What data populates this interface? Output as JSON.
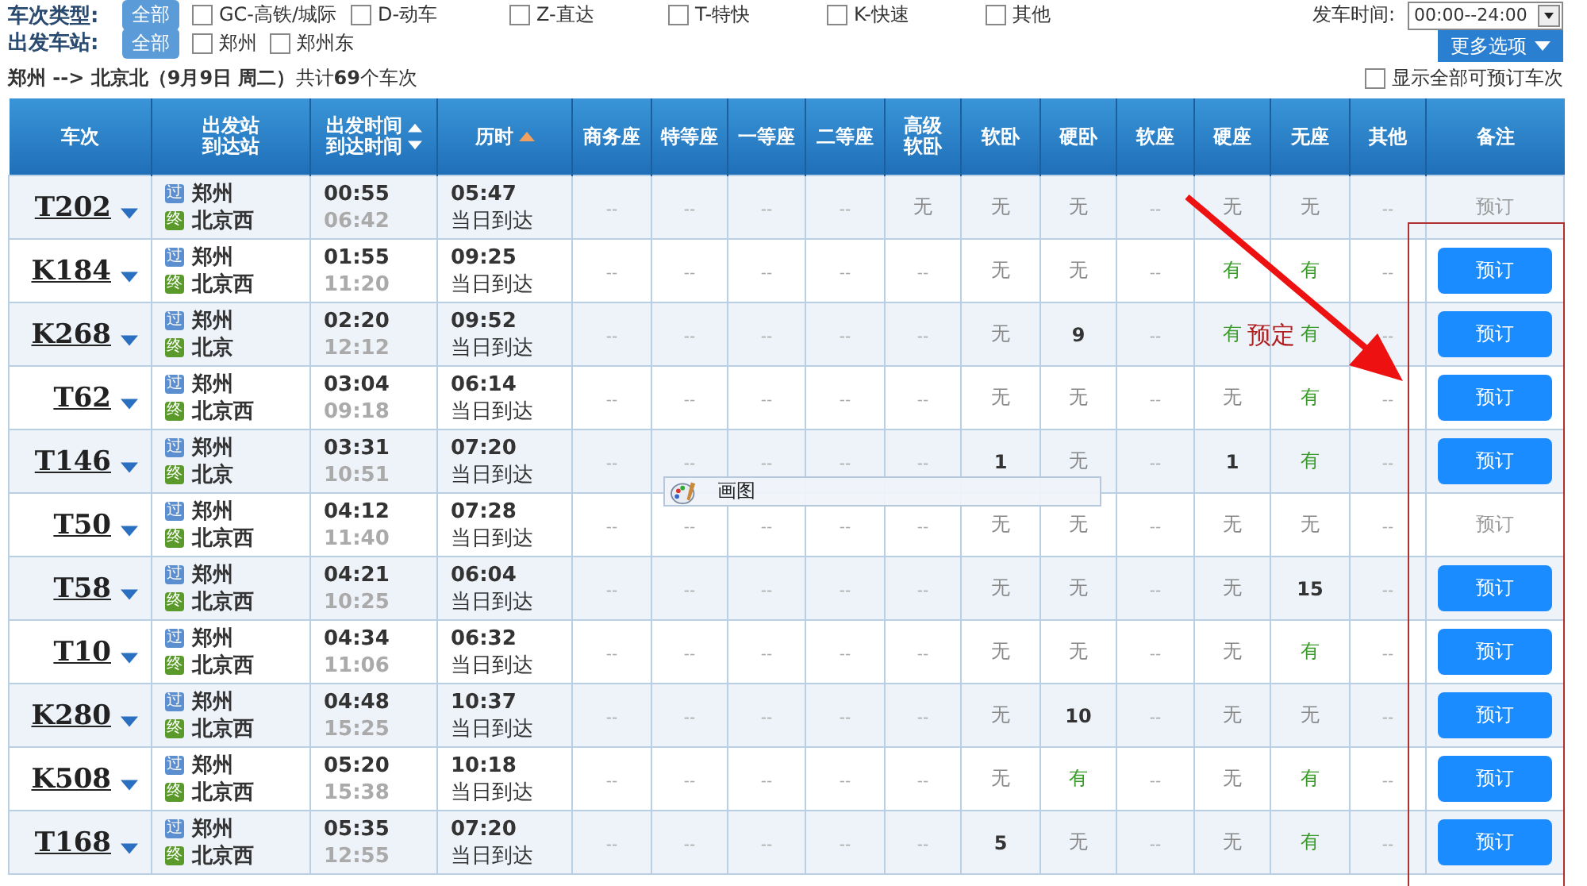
{
  "filters": {
    "train_type": {
      "label": "车次类型:",
      "all": {
        "label": "全部",
        "selected": true
      },
      "options": [
        {
          "label": "GC-高铁/城际",
          "checked": false
        },
        {
          "label": "D-动车",
          "checked": false
        },
        {
          "label": "Z-直达",
          "checked": false
        },
        {
          "label": "T-特快",
          "checked": false
        },
        {
          "label": "K-快速",
          "checked": false
        },
        {
          "label": "其他",
          "checked": false
        }
      ]
    },
    "depart_time": {
      "label": "发车时间:",
      "value": "00:00--24:00"
    },
    "station": {
      "label": "出发车站:",
      "all": {
        "label": "全部",
        "selected": true
      },
      "options": [
        {
          "label": "郑州",
          "checked": false
        },
        {
          "label": "郑州东",
          "checked": false
        }
      ]
    },
    "more_button": "更多选项"
  },
  "summary": "**郑州 --> 北京北（9月9日  周二）**共计**69**个车次",
  "show_all": {
    "label": "显示全部可预订车次",
    "checked": false
  },
  "columns": [
    {
      "label": "车次"
    },
    {
      "label": "出发站",
      "label2": "到达站"
    },
    {
      "label": "出发时间",
      "label2": "到达时间",
      "sort_up": true,
      "sort_down": true
    },
    {
      "label": "历时",
      "sort_up": true,
      "sort_down": false
    },
    {
      "label": "商务座"
    },
    {
      "label": "特等座"
    },
    {
      "label": "一等座"
    },
    {
      "label": "二等座"
    },
    {
      "label": "高级",
      "label2": "软卧"
    },
    {
      "label": "软卧"
    },
    {
      "label": "硬卧"
    },
    {
      "label": "软座"
    },
    {
      "label": "硬座"
    },
    {
      "label": "无座"
    },
    {
      "label": "其他"
    },
    {
      "label": "备注"
    }
  ],
  "rows": [
    {
      "train": "T202",
      "from_tag": "过",
      "from": "郑州",
      "to_tag": "终",
      "to": "北京西",
      "depart": "00:55",
      "arrive": "06:42",
      "duration": "05:47",
      "arrival_day": "当日到达",
      "seats": [
        {
          "text": "--",
          "kind": "na"
        },
        {
          "text": "--",
          "kind": "na"
        },
        {
          "text": "--",
          "kind": "na"
        },
        {
          "text": "--",
          "kind": "na"
        },
        {
          "text": "无",
          "kind": "none"
        },
        {
          "text": "无",
          "kind": "none"
        },
        {
          "text": "无",
          "kind": "none"
        },
        {
          "text": "--",
          "kind": "na"
        },
        {
          "text": "无",
          "kind": "none"
        },
        {
          "text": "无",
          "kind": "none"
        },
        {
          "text": "--",
          "kind": "na"
        }
      ],
      "remark": {
        "text": "预订",
        "enabled": false
      }
    },
    {
      "train": "K184",
      "from_tag": "过",
      "from": "郑州",
      "to_tag": "终",
      "to": "北京西",
      "depart": "01:55",
      "arrive": "11:20",
      "duration": "09:25",
      "arrival_day": "当日到达",
      "seats": [
        {
          "text": "--",
          "kind": "na"
        },
        {
          "text": "--",
          "kind": "na"
        },
        {
          "text": "--",
          "kind": "na"
        },
        {
          "text": "--",
          "kind": "na"
        },
        {
          "text": "--",
          "kind": "na"
        },
        {
          "text": "无",
          "kind": "none"
        },
        {
          "text": "无",
          "kind": "none"
        },
        {
          "text": "--",
          "kind": "na"
        },
        {
          "text": "有",
          "kind": "yes"
        },
        {
          "text": "有",
          "kind": "yes"
        },
        {
          "text": "--",
          "kind": "na"
        }
      ],
      "remark": {
        "text": "预订",
        "enabled": true
      }
    },
    {
      "train": "K268",
      "from_tag": "过",
      "from": "郑州",
      "to_tag": "终",
      "to": "北京",
      "depart": "02:20",
      "arrive": "12:12",
      "duration": "09:52",
      "arrival_day": "当日到达",
      "seats": [
        {
          "text": "--",
          "kind": "na"
        },
        {
          "text": "--",
          "kind": "na"
        },
        {
          "text": "--",
          "kind": "na"
        },
        {
          "text": "--",
          "kind": "na"
        },
        {
          "text": "--",
          "kind": "na"
        },
        {
          "text": "无",
          "kind": "none"
        },
        {
          "text": "9",
          "kind": "num"
        },
        {
          "text": "--",
          "kind": "na"
        },
        {
          "text": "有",
          "kind": "yes"
        },
        {
          "text": "有",
          "kind": "yes"
        },
        {
          "text": "--",
          "kind": "na"
        }
      ],
      "remark": {
        "text": "预订",
        "enabled": true
      }
    },
    {
      "train": "T62",
      "from_tag": "过",
      "from": "郑州",
      "to_tag": "终",
      "to": "北京西",
      "depart": "03:04",
      "arrive": "09:18",
      "duration": "06:14",
      "arrival_day": "当日到达",
      "seats": [
        {
          "text": "--",
          "kind": "na"
        },
        {
          "text": "--",
          "kind": "na"
        },
        {
          "text": "--",
          "kind": "na"
        },
        {
          "text": "--",
          "kind": "na"
        },
        {
          "text": "--",
          "kind": "na"
        },
        {
          "text": "无",
          "kind": "none"
        },
        {
          "text": "无",
          "kind": "none"
        },
        {
          "text": "--",
          "kind": "na"
        },
        {
          "text": "无",
          "kind": "none"
        },
        {
          "text": "有",
          "kind": "yes"
        },
        {
          "text": "--",
          "kind": "na"
        }
      ],
      "remark": {
        "text": "预订",
        "enabled": true
      }
    },
    {
      "train": "T146",
      "from_tag": "过",
      "from": "郑州",
      "to_tag": "终",
      "to": "北京",
      "depart": "03:31",
      "arrive": "10:51",
      "duration": "07:20",
      "arrival_day": "当日到达",
      "seats": [
        {
          "text": "--",
          "kind": "na"
        },
        {
          "text": "--",
          "kind": "na"
        },
        {
          "text": "--",
          "kind": "na"
        },
        {
          "text": "--",
          "kind": "na"
        },
        {
          "text": "--",
          "kind": "na"
        },
        {
          "text": "1",
          "kind": "num"
        },
        {
          "text": "无",
          "kind": "none"
        },
        {
          "text": "--",
          "kind": "na"
        },
        {
          "text": "1",
          "kind": "num"
        },
        {
          "text": "有",
          "kind": "yes"
        },
        {
          "text": "--",
          "kind": "na"
        }
      ],
      "remark": {
        "text": "预订",
        "enabled": true
      }
    },
    {
      "train": "T50",
      "from_tag": "过",
      "from": "郑州",
      "to_tag": "终",
      "to": "北京西",
      "depart": "04:12",
      "arrive": "11:40",
      "duration": "07:28",
      "arrival_day": "当日到达",
      "seats": [
        {
          "text": "--",
          "kind": "na"
        },
        {
          "text": "--",
          "kind": "na"
        },
        {
          "text": "--",
          "kind": "na"
        },
        {
          "text": "--",
          "kind": "na"
        },
        {
          "text": "--",
          "kind": "na"
        },
        {
          "text": "无",
          "kind": "none"
        },
        {
          "text": "无",
          "kind": "none"
        },
        {
          "text": "--",
          "kind": "na"
        },
        {
          "text": "无",
          "kind": "none"
        },
        {
          "text": "无",
          "kind": "none"
        },
        {
          "text": "--",
          "kind": "na"
        }
      ],
      "remark": {
        "text": "预订",
        "enabled": false
      }
    },
    {
      "train": "T58",
      "from_tag": "过",
      "from": "郑州",
      "to_tag": "终",
      "to": "北京西",
      "depart": "04:21",
      "arrive": "10:25",
      "duration": "06:04",
      "arrival_day": "当日到达",
      "seats": [
        {
          "text": "--",
          "kind": "na"
        },
        {
          "text": "--",
          "kind": "na"
        },
        {
          "text": "--",
          "kind": "na"
        },
        {
          "text": "--",
          "kind": "na"
        },
        {
          "text": "--",
          "kind": "na"
        },
        {
          "text": "无",
          "kind": "none"
        },
        {
          "text": "无",
          "kind": "none"
        },
        {
          "text": "--",
          "kind": "na"
        },
        {
          "text": "无",
          "kind": "none"
        },
        {
          "text": "15",
          "kind": "num"
        },
        {
          "text": "--",
          "kind": "na"
        }
      ],
      "remark": {
        "text": "预订",
        "enabled": true
      }
    },
    {
      "train": "T10",
      "from_tag": "过",
      "from": "郑州",
      "to_tag": "终",
      "to": "北京西",
      "depart": "04:34",
      "arrive": "11:06",
      "duration": "06:32",
      "arrival_day": "当日到达",
      "seats": [
        {
          "text": "--",
          "kind": "na"
        },
        {
          "text": "--",
          "kind": "na"
        },
        {
          "text": "--",
          "kind": "na"
        },
        {
          "text": "--",
          "kind": "na"
        },
        {
          "text": "--",
          "kind": "na"
        },
        {
          "text": "无",
          "kind": "none"
        },
        {
          "text": "无",
          "kind": "none"
        },
        {
          "text": "--",
          "kind": "na"
        },
        {
          "text": "无",
          "kind": "none"
        },
        {
          "text": "有",
          "kind": "yes"
        },
        {
          "text": "--",
          "kind": "na"
        }
      ],
      "remark": {
        "text": "预订",
        "enabled": true
      }
    },
    {
      "train": "K280",
      "from_tag": "过",
      "from": "郑州",
      "to_tag": "终",
      "to": "北京西",
      "depart": "04:48",
      "arrive": "15:25",
      "duration": "10:37",
      "arrival_day": "当日到达",
      "seats": [
        {
          "text": "--",
          "kind": "na"
        },
        {
          "text": "--",
          "kind": "na"
        },
        {
          "text": "--",
          "kind": "na"
        },
        {
          "text": "--",
          "kind": "na"
        },
        {
          "text": "--",
          "kind": "na"
        },
        {
          "text": "无",
          "kind": "none"
        },
        {
          "text": "10",
          "kind": "num"
        },
        {
          "text": "--",
          "kind": "na"
        },
        {
          "text": "无",
          "kind": "none"
        },
        {
          "text": "无",
          "kind": "none"
        },
        {
          "text": "--",
          "kind": "na"
        }
      ],
      "remark": {
        "text": "预订",
        "enabled": true
      }
    },
    {
      "train": "K508",
      "from_tag": "过",
      "from": "郑州",
      "to_tag": "终",
      "to": "北京西",
      "depart": "05:20",
      "arrive": "15:38",
      "duration": "10:18",
      "arrival_day": "当日到达",
      "seats": [
        {
          "text": "--",
          "kind": "na"
        },
        {
          "text": "--",
          "kind": "na"
        },
        {
          "text": "--",
          "kind": "na"
        },
        {
          "text": "--",
          "kind": "na"
        },
        {
          "text": "--",
          "kind": "na"
        },
        {
          "text": "无",
          "kind": "none"
        },
        {
          "text": "有",
          "kind": "yes"
        },
        {
          "text": "--",
          "kind": "na"
        },
        {
          "text": "无",
          "kind": "none"
        },
        {
          "text": "有",
          "kind": "yes"
        },
        {
          "text": "--",
          "kind": "na"
        }
      ],
      "remark": {
        "text": "预订",
        "enabled": true
      }
    },
    {
      "train": "T168",
      "from_tag": "过",
      "from": "郑州",
      "to_tag": "终",
      "to": "北京西",
      "depart": "05:35",
      "arrive": "12:55",
      "duration": "07:20",
      "arrival_day": "当日到达",
      "seats": [
        {
          "text": "--",
          "kind": "na"
        },
        {
          "text": "--",
          "kind": "na"
        },
        {
          "text": "--",
          "kind": "na"
        },
        {
          "text": "--",
          "kind": "na"
        },
        {
          "text": "--",
          "kind": "na"
        },
        {
          "text": "5",
          "kind": "num"
        },
        {
          "text": "无",
          "kind": "none"
        },
        {
          "text": "--",
          "kind": "na"
        },
        {
          "text": "无",
          "kind": "none"
        },
        {
          "text": "有",
          "kind": "yes"
        },
        {
          "text": "--",
          "kind": "na"
        }
      ],
      "remark": {
        "text": "预订",
        "enabled": true
      }
    }
  ],
  "popup": {
    "label": "画图"
  },
  "annotations": [
    {
      "kind": "arrow"
    },
    {
      "kind": "frame"
    },
    {
      "kind": "text",
      "text": "预定"
    }
  ]
}
